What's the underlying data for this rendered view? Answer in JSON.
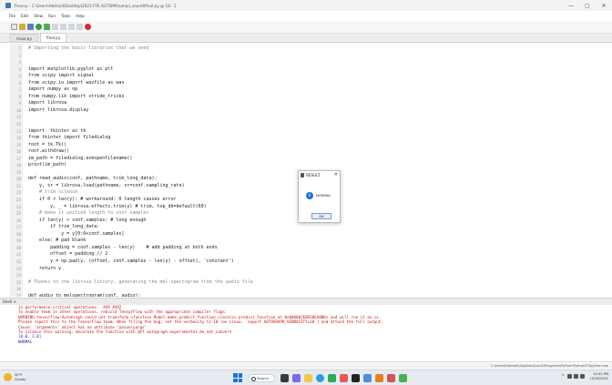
{
  "window": {
    "title": "Thonny - C:\\Users\\Hotmail\\Desktop\\2023 FYE AUTISM\\human_sound\\final.py @ 18 : 1",
    "controls": [
      "—",
      "▢",
      "✕"
    ]
  },
  "menu": [
    "File",
    "Edit",
    "View",
    "Run",
    "Tools",
    "Help"
  ],
  "tabs": [
    {
      "label": "main.py",
      "active": false
    },
    {
      "label": "final.py",
      "active": true
    }
  ],
  "code": [
    {
      "n": "1",
      "t": "# Importing the basic libraries that we need",
      "k": "cm"
    },
    {
      "n": "2",
      "t": "",
      "k": ""
    },
    {
      "n": "3",
      "t": "",
      "k": ""
    },
    {
      "n": "4",
      "t": "import matplotlib.pyplot as plt",
      "k": ""
    },
    {
      "n": "5",
      "t": "from scipy import signal",
      "k": ""
    },
    {
      "n": "6",
      "t": "from scipy.io import wavfile as wav",
      "k": ""
    },
    {
      "n": "7",
      "t": "import numpy as np",
      "k": ""
    },
    {
      "n": "8",
      "t": "from numpy.lib import stride_tricks",
      "k": ""
    },
    {
      "n": "9",
      "t": "import librosa",
      "k": ""
    },
    {
      "n": "10",
      "t": "import librosa.display",
      "k": ""
    },
    {
      "n": "11",
      "t": "",
      "k": ""
    },
    {
      "n": "12",
      "t": "",
      "k": ""
    },
    {
      "n": "13",
      "t": "import  tkinter as tk",
      "k": ""
    },
    {
      "n": "14",
      "t": "from tkinter import filedialog",
      "k": ""
    },
    {
      "n": "15",
      "t": "root = tk.Tk()",
      "k": ""
    },
    {
      "n": "16",
      "t": "root.withdraw()",
      "k": ""
    },
    {
      "n": "17",
      "t": "im_path = filedialog.askopenfilename()",
      "k": ""
    },
    {
      "n": "18",
      "t": "print(im_path)",
      "k": ""
    },
    {
      "n": "19",
      "t": "",
      "k": ""
    },
    {
      "n": "20",
      "t": "def read_audio(conf, pathname, trim_long_data):",
      "k": ""
    },
    {
      "n": "21",
      "t": "    y, sr = librosa.load(pathname, sr=conf.sampling_rate)",
      "k": ""
    },
    {
      "n": "22",
      "t": "    # trim silence",
      "k": "cm"
    },
    {
      "n": "23",
      "t": "    if 0 < len(y): # workaround: 0 length causes error",
      "k": ""
    },
    {
      "n": "24",
      "t": "        y, _ = librosa.effects.trim(y) # trim, top_db=default(60)",
      "k": ""
    },
    {
      "n": "25",
      "t": "    # make it unified length to conf.samples",
      "k": "cm"
    },
    {
      "n": "26",
      "t": "    if len(y) > conf.samples: # long enough",
      "k": ""
    },
    {
      "n": "27",
      "t": "        if trim_long_data:",
      "k": ""
    },
    {
      "n": "28",
      "t": "            y = y[0:0+conf.samples]",
      "k": ""
    },
    {
      "n": "29",
      "t": "    else: # pad blank",
      "k": ""
    },
    {
      "n": "30",
      "t": "        padding = conf.samples - len(y)    # add padding at both ends",
      "k": ""
    },
    {
      "n": "31",
      "t": "        offset = padding // 2",
      "k": ""
    },
    {
      "n": "32",
      "t": "        y = np.pad(y, (offset, conf.samples - len(y) - offset), 'constant')",
      "k": ""
    },
    {
      "n": "33",
      "t": "    return y",
      "k": ""
    },
    {
      "n": "34",
      "t": "",
      "k": ""
    },
    {
      "n": "35",
      "t": "# Thanks to the librosa library, generating the mel-spectogram from the audio file",
      "k": "cm"
    },
    {
      "n": "36",
      "t": "",
      "k": ""
    },
    {
      "n": "37",
      "t": "def audio_to_melspectrogram(conf, audio):",
      "k": ""
    }
  ],
  "shell": {
    "header": "Shell ×",
    "lines": [
      {
        "t": "in performance-critical operations:  AVX AVX2",
        "k": "err"
      },
      {
        "t": "To enable them in other operations, rebuild TensorFlow with the appropriate compiler flags.",
        "k": "err"
      },
      {
        "t": "WARNING:tensorflow:AutoGraph could not transform <function Model.make_predict_function.<locals>.predict_function at 0x000002E8D3DEA8B0> and will run it as-is.",
        "k": "err"
      },
      {
        "t": "Please report this to the TensorFlow team. When filing the bug, set the verbosity to 10 (on Linux, `export AUTOGRAPH_VERBOSITY=10`) and attach the full output.",
        "k": "err"
      },
      {
        "t": "Cause: 'arguments' object has no attribute 'posonlyargs'",
        "k": "err"
      },
      {
        "t": "To silence this warning, decorate the function with @tf.autograph.experimental.do_not_convert",
        "k": "err"
      },
      {
        "t": "[0.0, 1.0]",
        "k": "out"
      },
      {
        "t": "NORMAL",
        "k": "out"
      }
    ]
  },
  "status": "C:\\Users\\Hotmail\\AppData\\Local\\Programs\\Python\\Python37\\python.exe",
  "dialog": {
    "title": "RESULT",
    "message": "NORMAL",
    "ok_label": "OK",
    "close": "✕"
  },
  "taskbar": {
    "temp": "30°F",
    "weather": "Cloudy",
    "search_label": "Search",
    "time": "10:33 PM",
    "date": "12/18/2022",
    "chevron": "^"
  },
  "colors": {
    "accent": "#1d6fd8",
    "error_text": "#c01010",
    "output_text": "#1a1aa0"
  }
}
